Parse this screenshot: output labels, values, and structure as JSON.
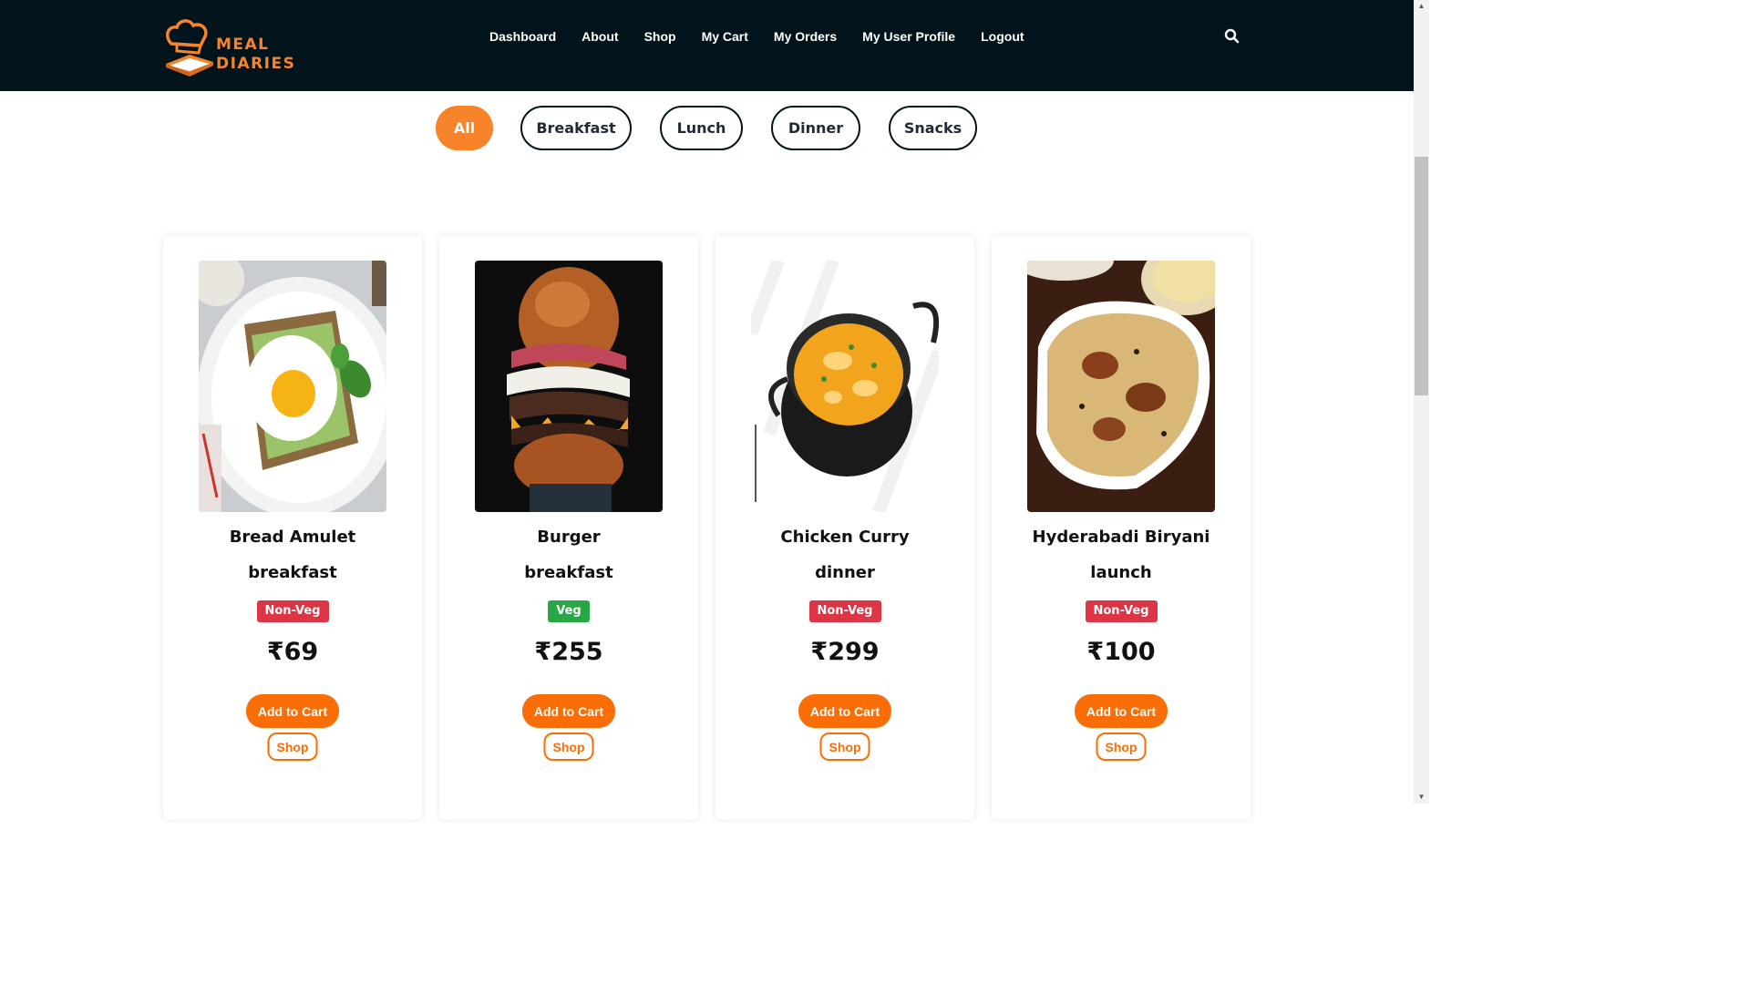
{
  "header": {
    "logo": {
      "line1": "MEAL",
      "line2": "DIARIES"
    },
    "nav": [
      {
        "label": "Dashboard"
      },
      {
        "label": "About"
      },
      {
        "label": "Shop"
      },
      {
        "label": "My Cart"
      },
      {
        "label": "My Orders"
      },
      {
        "label": "My User Profile"
      },
      {
        "label": "Logout"
      }
    ],
    "search_icon": "search-icon"
  },
  "filters": [
    {
      "label": "All",
      "active": true
    },
    {
      "label": "Breakfast",
      "active": false
    },
    {
      "label": "Lunch",
      "active": false
    },
    {
      "label": "Dinner",
      "active": false
    },
    {
      "label": "Snacks",
      "active": false
    }
  ],
  "products": [
    {
      "name": "Bread Amulet",
      "category": "breakfast",
      "type": "Non-Veg",
      "price": "₹69",
      "add_label": "Add to Cart",
      "shop_label": "Shop",
      "image": "avocado-toast-egg-photo"
    },
    {
      "name": "Burger",
      "category": "breakfast",
      "type": "Veg",
      "price": "₹255",
      "add_label": "Add to Cart",
      "shop_label": "Shop",
      "image": "burger-photo"
    },
    {
      "name": "Chicken Curry",
      "category": "dinner",
      "type": "Non-Veg",
      "price": "₹299",
      "add_label": "Add to Cart",
      "shop_label": "Shop",
      "image": "curry-bowl-photo"
    },
    {
      "name": "Hyderabadi Biryani",
      "category": "launch",
      "type": "Non-Veg",
      "price": "₹100",
      "add_label": "Add to Cart",
      "shop_label": "Shop",
      "image": "biryani-photo"
    }
  ],
  "colors": {
    "navbar": "#02141b",
    "accent": "#f7832a",
    "button": "#fb6e07",
    "nonveg": "#dc3545",
    "veg": "#28a745"
  }
}
